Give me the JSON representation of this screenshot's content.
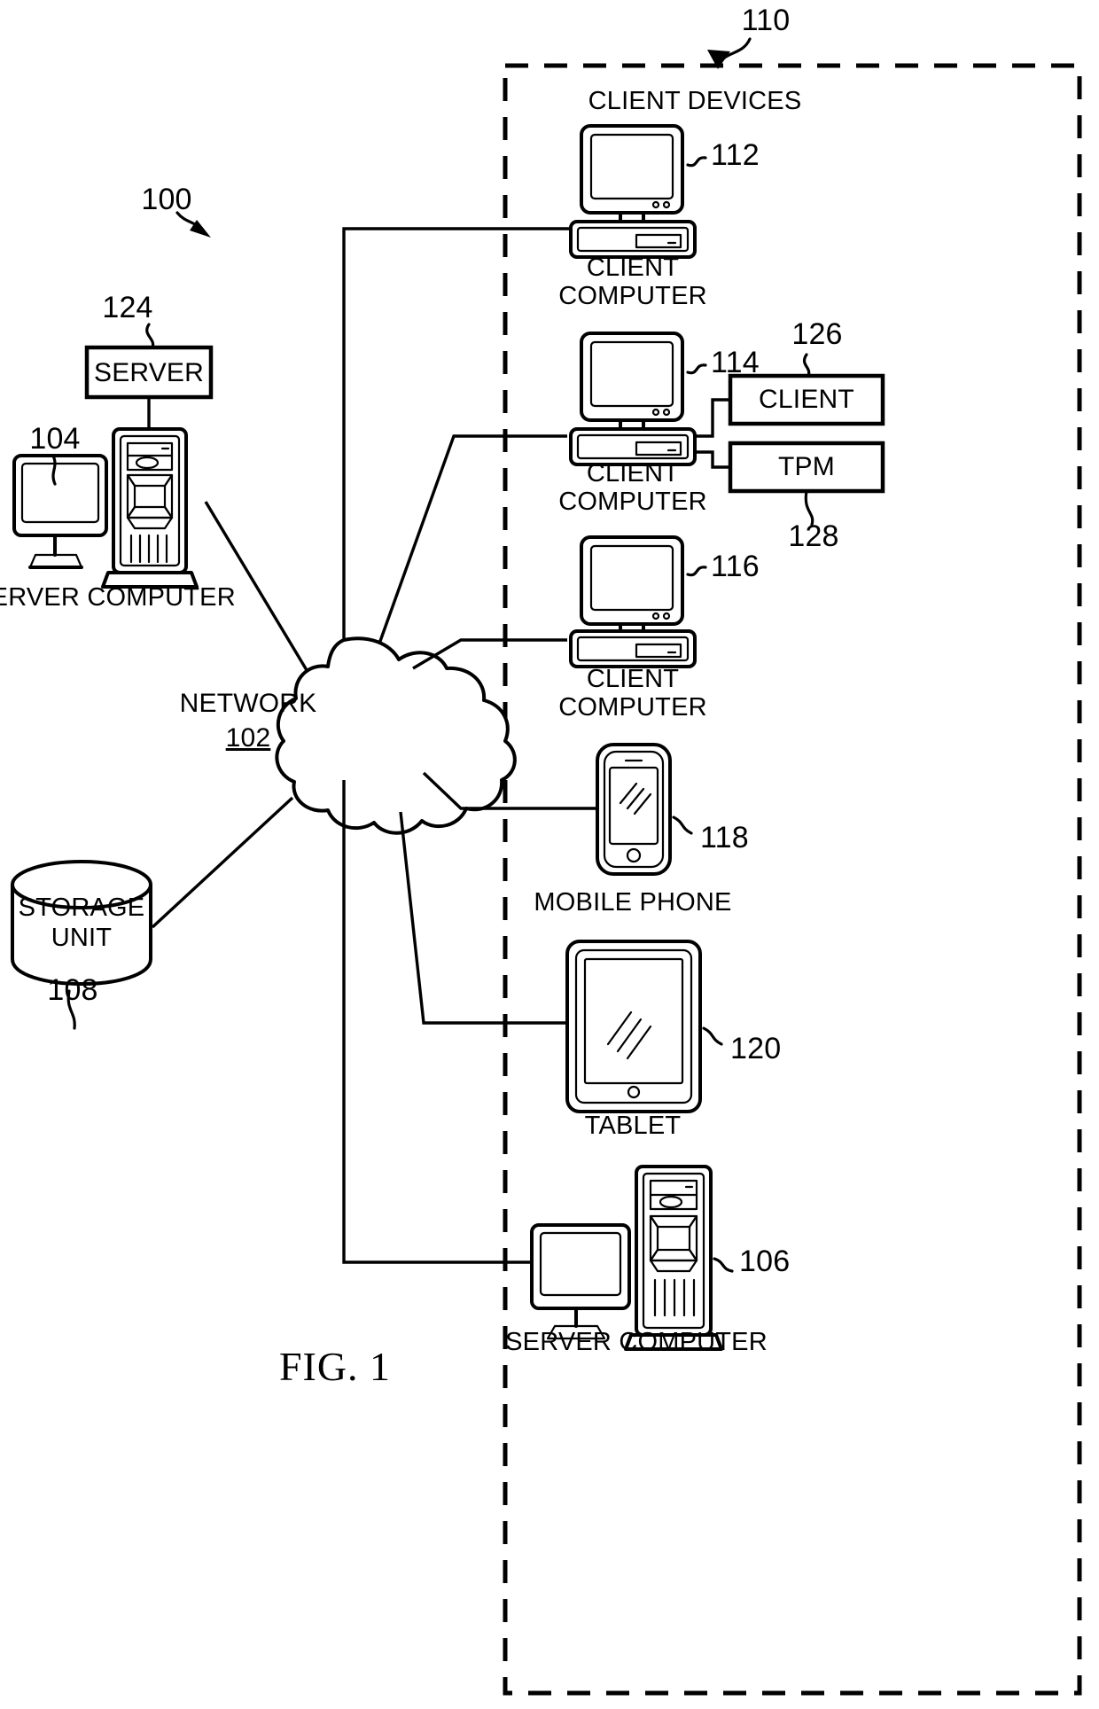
{
  "figure": {
    "title": "FIG. 1",
    "diagram_ref": "100",
    "dashed_group_ref": "110",
    "dashed_group_label": "CLIENT DEVICES"
  },
  "network": {
    "label": "NETWORK",
    "ref": "102"
  },
  "left_side": {
    "server_box": {
      "label": "SERVER",
      "ref": "124"
    },
    "server_computer": {
      "label": "SERVER COMPUTER",
      "ref": "104"
    },
    "storage_unit": {
      "label_line1": "STORAGE",
      "label_line2": "UNIT",
      "ref": "108"
    }
  },
  "client_devices": [
    {
      "name": "client-computer-112",
      "label_line1": "CLIENT",
      "label_line2": "COMPUTER",
      "ref": "112",
      "type": "desktop"
    },
    {
      "name": "client-computer-114",
      "label_line1": "CLIENT",
      "label_line2": "COMPUTER",
      "ref": "114",
      "type": "desktop"
    },
    {
      "name": "client-computer-116",
      "label_line1": "CLIENT",
      "label_line2": "COMPUTER",
      "ref": "116",
      "type": "desktop"
    },
    {
      "name": "mobile-phone-118",
      "label_line1": "MOBILE PHONE",
      "label_line2": "",
      "ref": "118",
      "type": "phone"
    },
    {
      "name": "tablet-120",
      "label_line1": "TABLET",
      "label_line2": "",
      "ref": "120",
      "type": "tablet"
    },
    {
      "name": "server-computer-106",
      "label_line1": "SERVER COMPUTER",
      "label_line2": "",
      "ref": "106",
      "type": "server"
    }
  ],
  "attached_modules": [
    {
      "label": "CLIENT",
      "ref": "126"
    },
    {
      "label": "TPM",
      "ref": "128"
    }
  ],
  "colors": {
    "ink": "#000000",
    "paper": "#ffffff"
  }
}
